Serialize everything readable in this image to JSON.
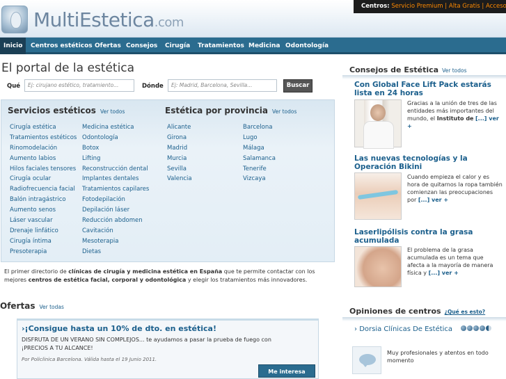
{
  "header": {
    "logo_main": "MultiEstetica",
    "logo_domain": ".com",
    "centros_label": "Centros:",
    "centros_links": [
      "Servicio Premium",
      "Alta Gratis",
      "Acceso"
    ]
  },
  "nav": [
    "Inicio",
    "Centros estéticos",
    "Ofertas",
    "Consejos",
    "Cirugía",
    "Tratamientos",
    "Medicina",
    "Odontología"
  ],
  "main": {
    "title": "El portal de la estética",
    "search": {
      "que_label": "Qué",
      "que_placeholder": "Ej: cirujano estético, tratamiento...",
      "donde_label": "Dónde",
      "donde_placeholder": "Ej: Madrid, Barcelona, Sevilla...",
      "button": "Buscar"
    },
    "servicios": {
      "title": "Servicios estéticos",
      "ver_todos": "Ver todos",
      "col1": [
        "Cirugía estética",
        "Tratamientos estéticos",
        "Rinomodelación",
        "Aumento labios",
        "Hilos faciales tensores",
        "Cirugía ocular",
        "Radiofrecuencia facial",
        "Balón intragástrico",
        "Aumento senos",
        "Láser vascular",
        "Drenaje linfático",
        "Cirugía íntima",
        "Presoterapia"
      ],
      "col2": [
        "Medicina estética",
        "Odontología",
        "Botox",
        "Lifting",
        "Reconstrucción dental",
        "Implantes dentales",
        "Tratamientos capilares",
        "Fotodepilación",
        "Depilación láser",
        "Reducción abdomen",
        "Cavitación",
        "Mesoterapia",
        "Dietas"
      ]
    },
    "provincias": {
      "title": "Estética por provincia",
      "ver_todos": "Ver todos",
      "col1": [
        "Alicante",
        "Girona",
        "Madrid",
        "Murcia",
        "Sevilla",
        "Valencia"
      ],
      "col2": [
        "Barcelona",
        "Lugo",
        "Málaga",
        "Salamanca",
        "Tenerife",
        "Vizcaya"
      ]
    },
    "intro": {
      "part1": "El primer directorio de ",
      "bold1": "clínicas de cirugía y medicina estética en España",
      "part2": " que te permite contactar con los mejores ",
      "bold2": "centros de estética facial, corporal y odontológica",
      "part3": " y elegir los tratamientos más innovadores."
    },
    "ofertas": {
      "title": "Ofertas",
      "ver_todas": "Ver todas",
      "offer_title": "¡Consigue hasta un 10% de dto. en estética!",
      "offer_text": "DISFRUTA DE UN VERANO SIN COMPLEJOS... te ayudamos a pasar la prueba de fuego con ¡PRECIOS A TU ALCANCE!",
      "offer_foot": "Por Policlinica Barcelona. Válida hasta el 19 Junio 2011.",
      "button": "Me interesa"
    }
  },
  "sidebar": {
    "consejos": {
      "title": "Consejos de Estética",
      "ver_todos": "Ver todos",
      "articles": [
        {
          "title": "Con Global Face Lift Pack estarás lista en 24 horas",
          "text": "Gracias a la unión de tres de las entidades más importantes del mundo, el ",
          "bold": "Instituto de",
          "more": "[...] ver +"
        },
        {
          "title": "Las nuevas tecnologías y la Operación Bikini",
          "text": "Cuando empieza el calor y es hora de quitarnos la ropa también comienzan las preocupaciones por ",
          "bold": "",
          "more": "[...] ver +"
        },
        {
          "title": "Laserlipólisis contra la grasa acumulada",
          "text": "El problema de la grasa acumulada es un tema que afecta a la mayoría de manera física y ",
          "bold": "",
          "more": "[...] ver +"
        }
      ]
    },
    "opiniones": {
      "title": "Opiniones de centros",
      "que_es": "¿Qué es esto?",
      "center": "Dorsia Clínicas De Estética",
      "rating": 4.5,
      "comment": "Muy profesionales y atentos en todo momento"
    }
  }
}
